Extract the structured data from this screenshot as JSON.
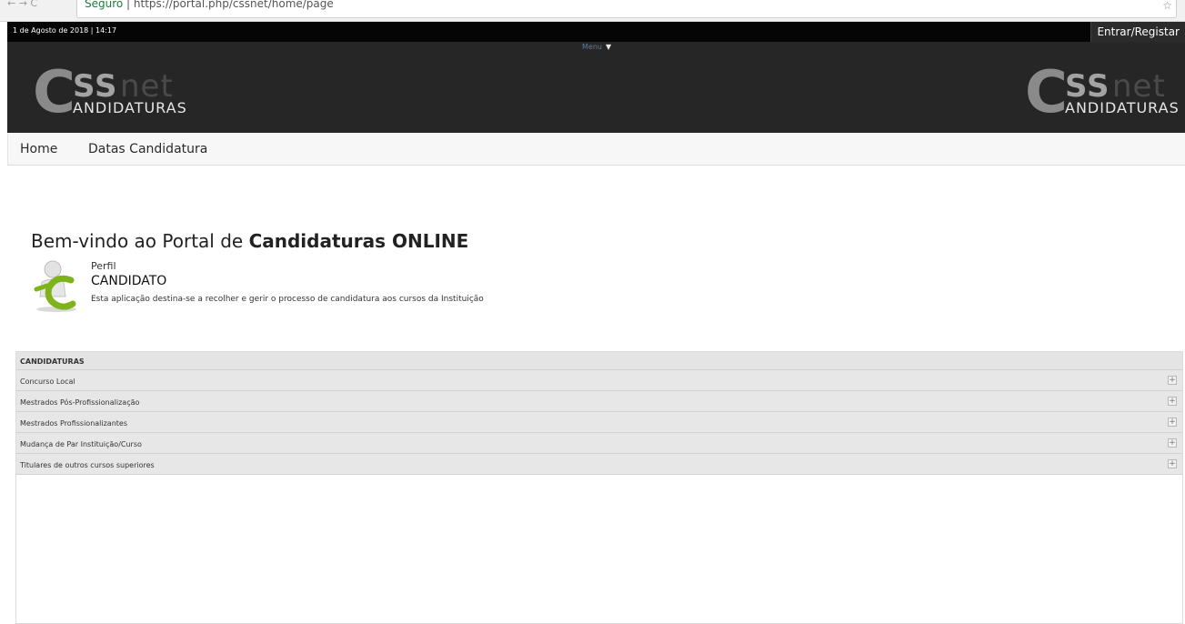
{
  "browser": {
    "nav_arrows": "← → C",
    "address_secure": "Seguro",
    "address_rest": " | https://portal.php/cssnet/home/page",
    "star": "☆"
  },
  "topbar": {
    "date": "1 de Agosto de 2018 | 14:17",
    "login_label": "Entrar/Registar"
  },
  "subbar": {
    "toggle_label": "Menu",
    "caret": "▼"
  },
  "logo": {
    "big_letter": "C",
    "ss": "SS",
    "net": "net",
    "sub": "ANDIDATURAS"
  },
  "menu": {
    "items": [
      {
        "label": "Home"
      },
      {
        "label": "Datas Candidatura"
      }
    ]
  },
  "welcome": {
    "prefix": "Bem-vindo ao Portal de ",
    "bold": "Candidaturas ONLINE",
    "perfil_label": "Perfil",
    "role": "CANDIDATO",
    "description": "Esta aplicação destina-se a recolher e gerir o processo de candidatura aos cursos da Instituição"
  },
  "candidaturas": {
    "title": "CANDIDATURAS",
    "expand_glyph": "+",
    "rows": [
      {
        "label": "Concurso Local"
      },
      {
        "label": "Mestrados Pós-Profissionalização"
      },
      {
        "label": "Mestrados Profissionalizantes"
      },
      {
        "label": "Mudança de Par Instituição/Curso"
      },
      {
        "label": "Titulares de outros cursos superiores"
      }
    ]
  },
  "colors": {
    "topbar": "#050505",
    "header": "#262626",
    "accent_green": "#7fb31c",
    "row_bg": "#e7e7e7"
  }
}
